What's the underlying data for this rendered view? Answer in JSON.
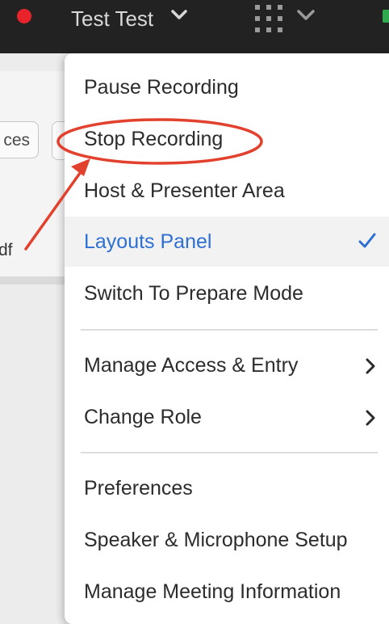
{
  "header": {
    "user_name": "Test Test",
    "icons": [
      "recording-dot-icon",
      "chevron-down-icon",
      "apps-grid-icon",
      "chevron-down-icon"
    ]
  },
  "background": {
    "button_fragment": "ces",
    "file_fragment": "df"
  },
  "menu": {
    "items": [
      {
        "label": "Pause Recording"
      },
      {
        "label": "Stop Recording"
      },
      {
        "label": "Host & Presenter Area"
      },
      {
        "label": "Layouts Panel",
        "checked": true
      },
      {
        "label": "Switch To Prepare Mode"
      },
      {
        "label": "Manage Access & Entry",
        "submenu": true
      },
      {
        "label": "Change Role",
        "submenu": true
      },
      {
        "label": "Preferences"
      },
      {
        "label": "Speaker & Microphone Setup"
      },
      {
        "label": "Manage Meeting Information"
      }
    ]
  },
  "colors": {
    "topbar": "#222222",
    "recording": "#e8232c",
    "selected_text": "#2d6fd2",
    "annotation": "#e2412e"
  }
}
